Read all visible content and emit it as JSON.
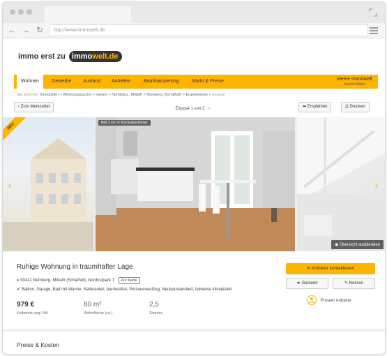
{
  "browser": {
    "url": "http://www.immowelt.de",
    "back_icon": "arrow-left-icon",
    "forward_icon": "arrow-right-icon",
    "reload_icon": "reload-icon"
  },
  "logo": {
    "prefix": "immo erst zu",
    "badge_part1": "immo",
    "badge_part2": "welt.de"
  },
  "nav": {
    "items": [
      {
        "label": "Wohnen"
      },
      {
        "label": "Gewerbe"
      },
      {
        "label": "Ausland"
      },
      {
        "label": "Anbieten"
      },
      {
        "label": "Baufinanzierung"
      },
      {
        "label": "Markt & Preise"
      }
    ],
    "account_title": "Meine Immowelt",
    "account_user": "Sandro Müller"
  },
  "breadcrumb": {
    "prefix": "Sie sind hier:",
    "path": "Immobilien > Wohnungssuche > mieten > Nürnberg , Mittelfr > Nürnberg (Schafhof) > Ergebnisliste >",
    "current": "Exposé"
  },
  "toolbar": {
    "back_label": "Zum Merkzettel",
    "expose_count": "Exposé 1 von 2",
    "recommend_label": "Empfehlen",
    "print_label": "Drucken"
  },
  "gallery": {
    "badge_new": "NEU",
    "image_label": "Bild 2 von 4: Küche/Essimmer",
    "overview_label": "Übersicht ausblenden"
  },
  "listing": {
    "title": "Ruhige Wohnung in traumhafter Lage",
    "address": "90411 Nürnberg, Mittelfr (Schafhof), Nordostpark 7",
    "map_label": "Zur Karte",
    "features": "Balkon, Garage, Bad mit Wanne, Kelleranteil, barrierefrei, Personenaufzug, Neubaustandard, teilweise klimatisiert",
    "price_value": "979 €",
    "price_label": "Kaltmiete zzgl. NK",
    "area_value": "80 m²",
    "area_label": "Wohnfläche (ca.)",
    "rooms_value": "2,5",
    "rooms_label": "Zimmer"
  },
  "actions": {
    "contact_label": "Anbieter kontaktieren",
    "bookmark_label": "Gemerkt",
    "notes_label": "Notizen",
    "provider_label": "Privater Anbieter"
  },
  "section": {
    "title": "Preise & Kosten"
  },
  "colors": {
    "accent": "#ffb400",
    "dark": "#333333"
  }
}
